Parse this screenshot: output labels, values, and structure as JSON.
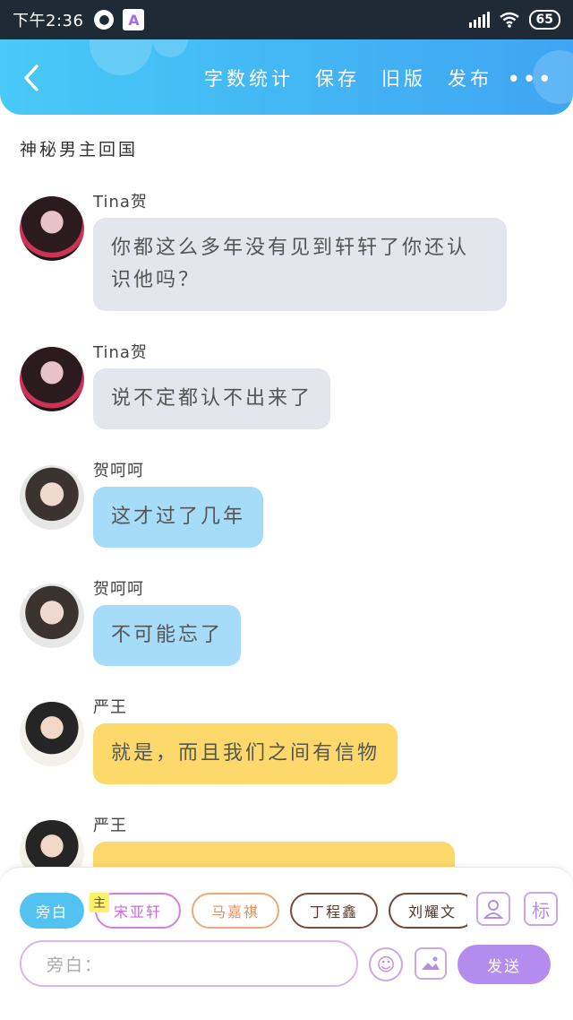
{
  "status_bar": {
    "time": "下午2:36",
    "app_icon_1": "●",
    "app_icon_2": "A",
    "battery": "65"
  },
  "header": {
    "back_icon": "chevron-left-icon",
    "actions": [
      "字数统计",
      "保存",
      "旧版",
      "发布"
    ],
    "more_label": "•••"
  },
  "story": {
    "title": "神秘男主回国"
  },
  "messages": [
    {
      "name": "Tina贺",
      "text": "你都这么多年没有见到轩轩了你还认识他吗？",
      "color": "gray"
    },
    {
      "name": "Tina贺",
      "text": "说不定都认不出来了",
      "color": "gray"
    },
    {
      "name": "贺呵呵",
      "text": "这才过了几年",
      "color": "blue"
    },
    {
      "name": "贺呵呵",
      "text": "不可能忘了",
      "color": "blue"
    },
    {
      "name": "严王",
      "text": "就是，而且我们之间有信物",
      "color": "yellow"
    },
    {
      "name": "严王",
      "text": "",
      "color": "yellow"
    }
  ],
  "bottom": {
    "roles": [
      "旁白",
      "宋亚轩",
      "马嘉祺",
      "丁程鑫",
      "刘耀文"
    ],
    "main_tag": "主",
    "tag_label": "标",
    "input_placeholder": "旁白：",
    "send_label": "发送",
    "emoji_icon": "☺",
    "image_icon": "▲"
  },
  "colors": {
    "header_gradient_start": "#48c9f6",
    "header_gradient_end": "#3fa5f3",
    "bubble_gray": "#e4e6ee",
    "bubble_blue": "#a6dcf8",
    "bubble_yellow": "#fcd96a",
    "send_button": "#b48cee"
  }
}
